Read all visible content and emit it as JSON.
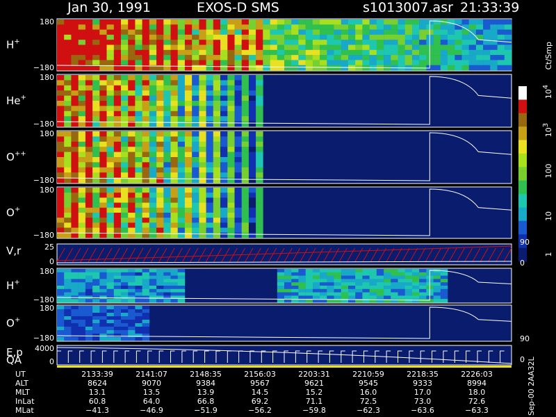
{
  "header": {
    "date": "Jan 30, 1991",
    "instrument": "EXOS-D SMS",
    "file": "s1013007.asr",
    "time": "21:33:39"
  },
  "colorbar": {
    "unit": "Ct/Smp",
    "ticks": [
      "1",
      "10",
      "100",
      "10",
      "10"
    ],
    "tick_exps": [
      "",
      "",
      "",
      "3",
      "4"
    ],
    "side_ticks": [
      "90",
      "0",
      "90",
      "0"
    ]
  },
  "colors": {
    "background": "#000000",
    "panel_bg": "#0a1c6e",
    "line": "#ffffff",
    "velocity_trace": "#d01010",
    "qa_bar": "#e8e020"
  },
  "panels": [
    {
      "name": "H",
      "sup": "+",
      "ymax": "180",
      "ymin": "−180"
    },
    {
      "name": "He",
      "sup": "+",
      "ymax": "180",
      "ymin": "−180"
    },
    {
      "name": "O",
      "sup": "++",
      "ymax": "180",
      "ymin": "−180"
    },
    {
      "name": "O",
      "sup": "+",
      "ymax": "180",
      "ymin": "−180"
    },
    {
      "name": "V,r",
      "sup": "",
      "ymax": "25",
      "ymin": "0"
    },
    {
      "name": "H",
      "sup": "+",
      "ymax": "180",
      "ymin": "−180"
    },
    {
      "name": "O",
      "sup": "+",
      "ymax": "180",
      "ymin": "−180"
    },
    {
      "name": "E,p",
      "sup": "",
      "ymax": "4000",
      "ymin": "0"
    }
  ],
  "qa_label": "QA",
  "footer_code": "Sep-00 2AA32L",
  "chart_data": {
    "type": "heatmap",
    "title": "Jan 30, 1991   EXOS-D SMS",
    "colorscale_unit": "Ct/Smp",
    "colorscale_range": [
      1,
      10000
    ],
    "colorscale_log": true,
    "rows": [
      {
        "label": "UT",
        "values": [
          "2133:39",
          "2141:07",
          "2148:35",
          "2156:03",
          "2203:31",
          "2210:59",
          "2218:35",
          "2226:03"
        ]
      },
      {
        "label": "ALT",
        "values": [
          "8624",
          "9070",
          "9384",
          "9567",
          "9621",
          "9545",
          "9333",
          "8994"
        ]
      },
      {
        "label": "MLT",
        "values": [
          "13.1",
          "13.5",
          "13.9",
          "14.5",
          "15.2",
          "16.0",
          "17.0",
          "18.0"
        ]
      },
      {
        "label": "InLat",
        "values": [
          "60.8",
          "64.0",
          "66.8",
          "69.2",
          "71.1",
          "72.5",
          "73.0",
          "72.6"
        ]
      },
      {
        "label": "MLat",
        "values": [
          "−41.3",
          "−46.9",
          "−51.9",
          "−56.2",
          "−59.8",
          "−62.3",
          "−63.6",
          "−63.3"
        ]
      }
    ]
  }
}
